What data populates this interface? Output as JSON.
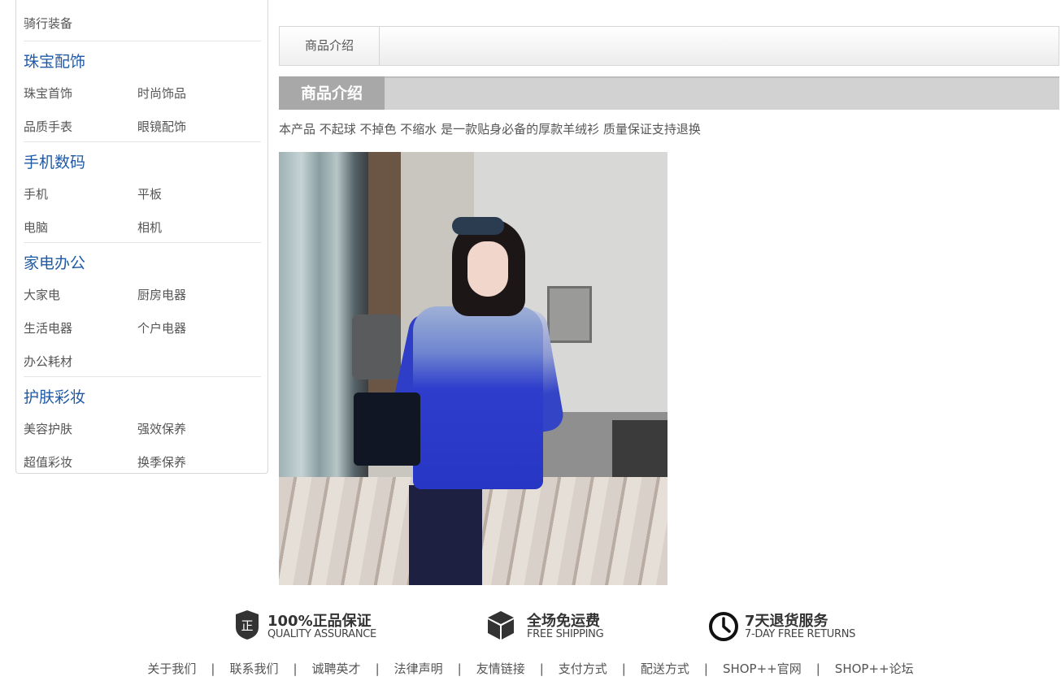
{
  "categories": {
    "top_item": "骑行装备",
    "groups": [
      {
        "title": "珠宝配饰",
        "rows": [
          [
            "珠宝首饰",
            "时尚饰品"
          ],
          [
            "品质手表",
            "眼镜配饰"
          ]
        ]
      },
      {
        "title": "手机数码",
        "rows": [
          [
            "手机",
            "平板"
          ],
          [
            "电脑",
            "相机"
          ]
        ]
      },
      {
        "title": "家电办公",
        "rows": [
          [
            "大家电",
            "厨房电器"
          ],
          [
            "生活电器",
            "个户电器"
          ],
          [
            "办公耗材",
            ""
          ]
        ]
      },
      {
        "title": "护肤彩妆",
        "rows": [
          [
            "美容护肤",
            "强效保养"
          ],
          [
            "超值彩妆",
            "换季保养"
          ]
        ]
      }
    ]
  },
  "tabs": [
    {
      "label": "商品介绍"
    }
  ],
  "section": {
    "title": "商品介绍",
    "description": "本产品 不起球 不掉色 不缩水 是一款贴身必备的厚款羊绒衫 质量保证支持退换"
  },
  "guarantees": [
    {
      "icon": "shield-icon",
      "title": "100%正品保证",
      "subtitle": "QUALITY ASSURANCE"
    },
    {
      "icon": "box-icon",
      "title": "全场免运费",
      "subtitle": "FREE SHIPPING"
    },
    {
      "icon": "clock-icon",
      "title": "7天退货服务",
      "subtitle": "7-DAY FREE RETURNS"
    }
  ],
  "footer": {
    "links": [
      "关于我们",
      "联系我们",
      "诚聘英才",
      "法律声明",
      "友情链接",
      "支付方式",
      "配送方式",
      "SHOP++官网",
      "SHOP++论坛"
    ],
    "separator": "|"
  },
  "colors": {
    "category_title": "#1f5aa6",
    "section_label_bg": "#a8a8a8",
    "section_bar_bg": "#d2d2d2"
  }
}
